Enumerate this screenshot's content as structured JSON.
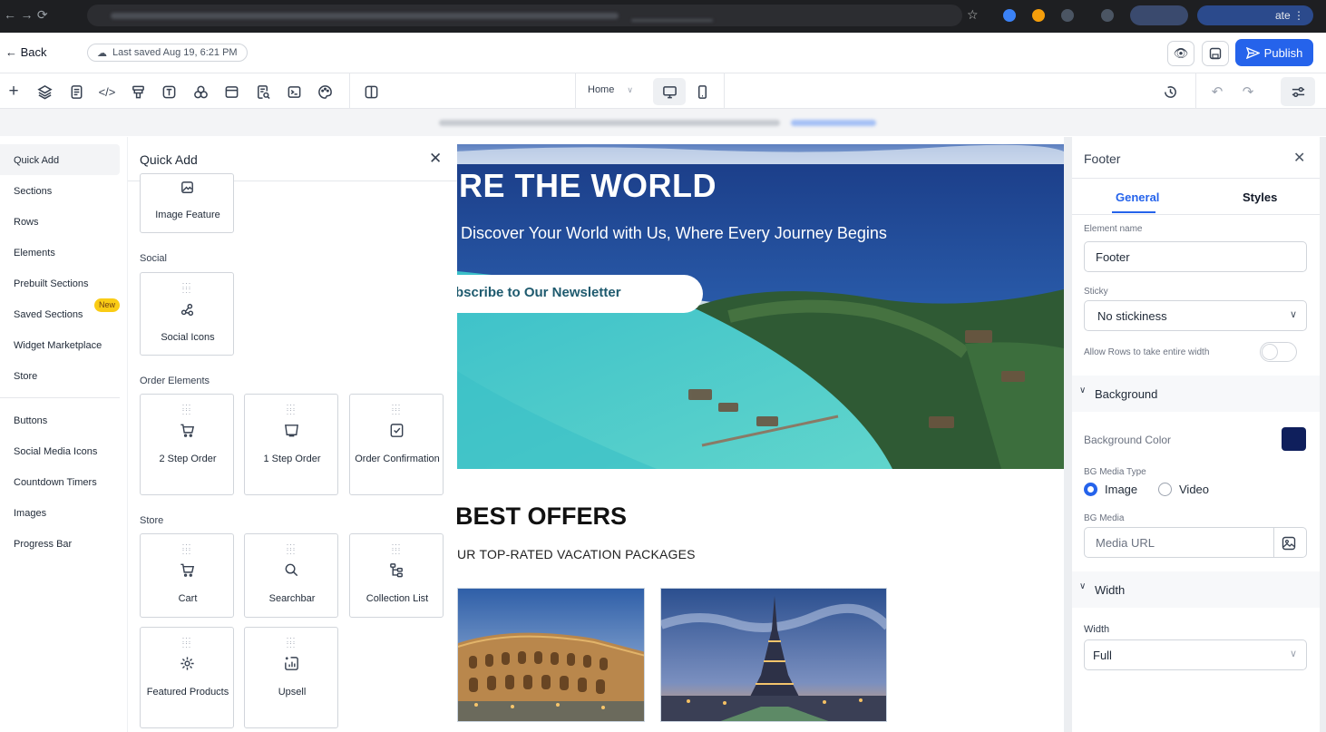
{
  "browser": {
    "update_label": "Relaunch to update",
    "update_visible": "ate"
  },
  "topbar": {
    "back_label": "← Back",
    "saved_label": "Last saved Aug 19, 6:21 PM",
    "publish_label": "Publish"
  },
  "toolbar": {
    "page_select": "Home"
  },
  "category_nav": {
    "items": [
      "Quick Add",
      "Sections",
      "Rows",
      "Elements",
      "Prebuilt Sections",
      "Saved Sections",
      "Widget Marketplace",
      "Store",
      "Buttons",
      "Social Media Icons",
      "Countdown Timers",
      "Images",
      "Progress Bar"
    ],
    "new_badge": "New"
  },
  "quick_add": {
    "title": "Quick Add",
    "top_card": "Image Feature",
    "groups": {
      "social": "Social",
      "order": "Order Elements",
      "store": "Store"
    },
    "cards": {
      "social_icons": "Social Icons",
      "two_step": "2 Step Order",
      "one_step": "1 Step Order",
      "order_conf": "Order Confirmation",
      "cart": "Cart",
      "searchbar": "Searchbar",
      "collection": "Collection List",
      "featured": "Featured Products",
      "upsell": "Upsell"
    }
  },
  "canvas": {
    "hero_title": "RE THE WORLD",
    "hero_subtitle": "Discover Your World with Us, Where Every Journey Begins",
    "hero_button": "bscribe to Our Newsletter",
    "offers_title": "BEST OFFERS",
    "offers_subtitle": "UR TOP-RATED VACATION PACKAGES"
  },
  "settings": {
    "title": "Footer",
    "tabs": [
      "General",
      "Styles"
    ],
    "element_name_label": "Element name",
    "element_name_value": "Footer",
    "sticky_label": "Sticky",
    "sticky_value": "No stickiness",
    "rows_width_label": "Allow Rows to take entire width",
    "rows_width_on": false,
    "background_section": "Background",
    "bg_color_label": "Background Color",
    "bg_color": "#0f1f5c",
    "bg_media_type_label": "BG Media Type",
    "media_types": [
      "Image",
      "Video"
    ],
    "media_type_selected": "Image",
    "bg_media_label": "BG Media",
    "bg_media_placeholder": "Media URL",
    "width_section": "Width",
    "width_label": "Width",
    "width_value": "Full"
  },
  "colors": {
    "accent": "#2563eb",
    "badge": "#facc15"
  }
}
